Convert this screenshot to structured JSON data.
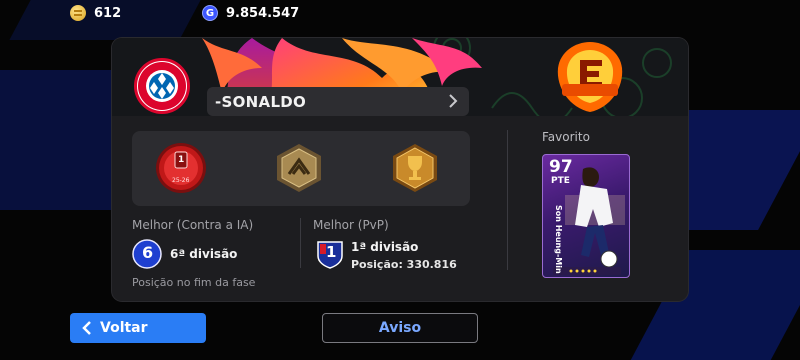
{
  "currency": {
    "coins": "612",
    "gp": "9.854.547",
    "gp_icon_letter": "G"
  },
  "profile": {
    "club_logo_text": "FC BAYERN MÜNCHEN",
    "username": "-SONALDO",
    "ef_logo_text": "FOOTBALL"
  },
  "trophies": [
    {
      "name": "season-division-1-trophy",
      "rank": "1",
      "season": "25-26"
    },
    {
      "name": "bronze-hexagon-emblem"
    },
    {
      "name": "gold-hexagon-trophy"
    }
  ],
  "best_ai": {
    "label": "Melhor (Contra a IA)",
    "division_number": "6",
    "division_text": "6ª divisão",
    "footnote": "Posição no fim da fase"
  },
  "best_pvp": {
    "label": "Melhor (PvP)",
    "division_number": "1",
    "division_text": "1ª divisão",
    "position_text": "Posição: 330.816"
  },
  "favorite": {
    "label": "Favorito",
    "rating": "97",
    "position": "PTE",
    "player_name": "Son Heung-Min"
  },
  "buttons": {
    "back": "Voltar",
    "notice": "Aviso"
  },
  "colors": {
    "accent_blue": "#2a7df5",
    "card_bg": "#1d1d20",
    "panel_bg": "#2c2c30"
  }
}
